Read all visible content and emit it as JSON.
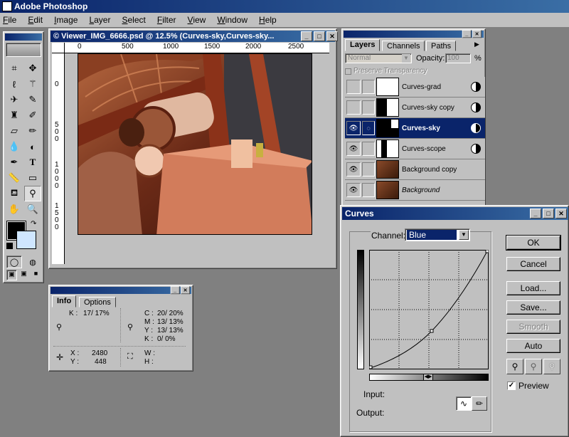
{
  "app": {
    "title": "Adobe Photoshop"
  },
  "menu": [
    "File",
    "Edit",
    "Image",
    "Layer",
    "Select",
    "Filter",
    "View",
    "Window",
    "Help"
  ],
  "viewer": {
    "title": "© Viewer_IMG_6666.psd @ 12.5% (Curves-sky,Curves-sky...",
    "ruler_h": [
      "0",
      "500",
      "1000",
      "1500",
      "2000",
      "2500"
    ],
    "ruler_v": [
      "0",
      "5 0 0",
      "1 0 0 0",
      "1 5 0 0"
    ]
  },
  "layers_panel": {
    "tabs": [
      "Layers",
      "Channels",
      "Paths"
    ],
    "blend_mode": "Normal",
    "opacity_label": "Opacity:",
    "opacity_value": "100",
    "opacity_unit": "%",
    "preserve_transparency": "Preserve Transparency",
    "layers": [
      {
        "name": "Curves-grad",
        "visible": false,
        "selected": false,
        "italic": false
      },
      {
        "name": "Curves-sky copy",
        "visible": false,
        "selected": false,
        "italic": false
      },
      {
        "name": "Curves-sky",
        "visible": true,
        "selected": true,
        "italic": false
      },
      {
        "name": "Curves-scope",
        "visible": true,
        "selected": false,
        "italic": false
      },
      {
        "name": "Background copy",
        "visible": true,
        "selected": false,
        "italic": false
      },
      {
        "name": "Background",
        "visible": true,
        "selected": false,
        "italic": true
      }
    ]
  },
  "info_panel": {
    "tabs": [
      "Info",
      "Options"
    ],
    "k_label": "K :",
    "k_value": "17/ 17%",
    "c_label": "C :",
    "c_value": "20/ 20%",
    "m_label": "M :",
    "m_value": "13/ 13%",
    "y_label": "Y :",
    "y_value": "13/ 13%",
    "k2_label": "K :",
    "k2_value": "0/  0%",
    "x_label": "X :",
    "x_value": "2480",
    "yc_label": "Y :",
    "yc_value": "448",
    "w_label": "W :",
    "h_label": "H :"
  },
  "curves": {
    "title": "Curves",
    "channel_label": "Channel:",
    "channel_value": "Blue",
    "buttons": {
      "ok": "OK",
      "cancel": "Cancel",
      "load": "Load...",
      "save": "Save...",
      "smooth": "Smooth",
      "auto": "Auto"
    },
    "preview_label": "Preview",
    "preview_checked": true,
    "input_label": "Input:",
    "output_label": "Output:"
  }
}
